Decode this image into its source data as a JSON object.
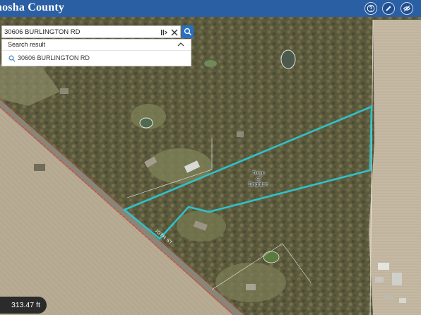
{
  "app": {
    "title": "nosha County"
  },
  "toolbar": {
    "buttons": [
      {
        "name": "help",
        "icon": "question-icon"
      },
      {
        "name": "edit",
        "icon": "pencil-icon"
      },
      {
        "name": "layers",
        "icon": "layers-toggle-icon"
      }
    ]
  },
  "search": {
    "value": "30606 BURLINGTON RD",
    "results_header": "Search result",
    "results": [
      "30606 BURLINGTON RD"
    ]
  },
  "map": {
    "labels": {
      "town": "Town\nof\nBrighton",
      "road": "JOTH ST"
    },
    "parcel_outline_color": "#2fc1c9",
    "road_edge_color": "#d84a3a"
  },
  "scale_bar": {
    "text": "313.47 ft"
  },
  "colors": {
    "header": "#2a5fa3",
    "search_button": "#2a6fc2"
  }
}
